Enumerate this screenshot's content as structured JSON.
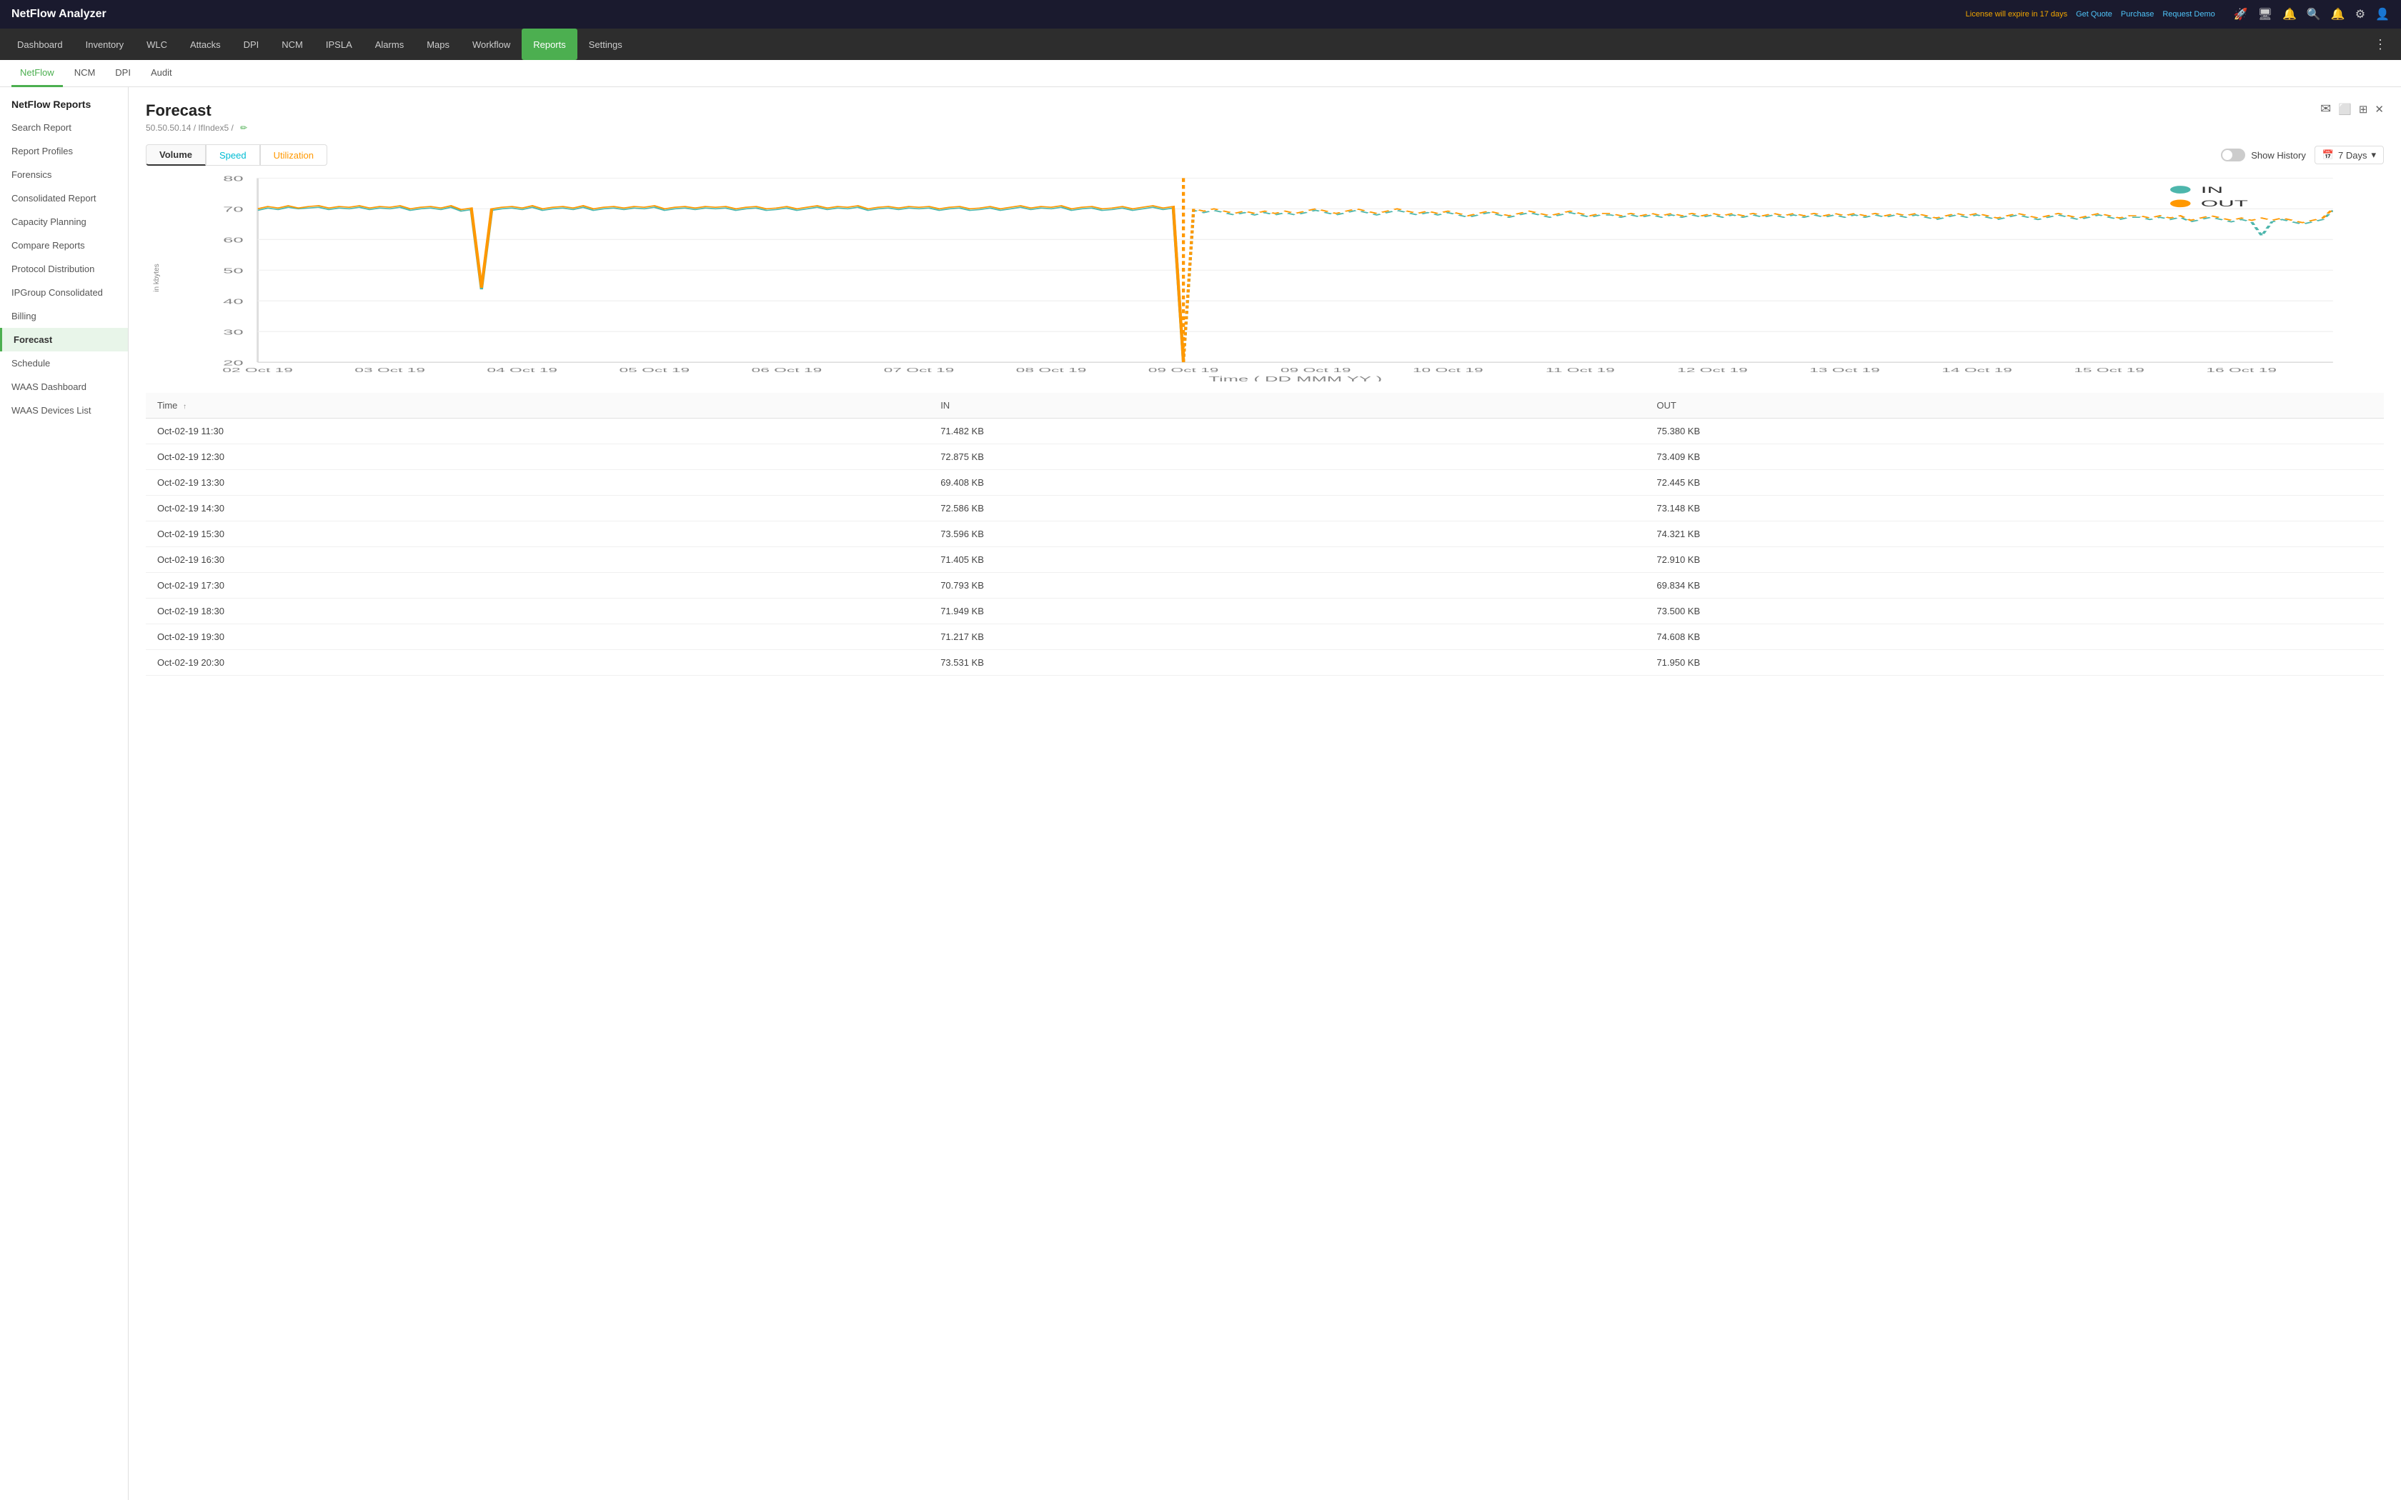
{
  "app": {
    "title": "NetFlow",
    "title_accent": " Analyzer"
  },
  "topbar": {
    "license": "License will expire in 17 days",
    "get_quote": "Get Quote",
    "purchase": "Purchase",
    "request_demo": "Request Demo"
  },
  "main_nav": {
    "items": [
      {
        "label": "Dashboard",
        "active": false
      },
      {
        "label": "Inventory",
        "active": false
      },
      {
        "label": "WLC",
        "active": false
      },
      {
        "label": "Attacks",
        "active": false
      },
      {
        "label": "DPI",
        "active": false
      },
      {
        "label": "NCM",
        "active": false
      },
      {
        "label": "IPSLA",
        "active": false
      },
      {
        "label": "Alarms",
        "active": false
      },
      {
        "label": "Maps",
        "active": false
      },
      {
        "label": "Workflow",
        "active": false
      },
      {
        "label": "Reports",
        "active": true
      },
      {
        "label": "Settings",
        "active": false
      }
    ]
  },
  "sub_nav": {
    "items": [
      {
        "label": "NetFlow",
        "active": true
      },
      {
        "label": "NCM",
        "active": false
      },
      {
        "label": "DPI",
        "active": false
      },
      {
        "label": "Audit",
        "active": false
      }
    ]
  },
  "sidebar": {
    "title": "NetFlow Reports",
    "items": [
      {
        "label": "Search Report",
        "active": false
      },
      {
        "label": "Report Profiles",
        "active": false
      },
      {
        "label": "Forensics",
        "active": false
      },
      {
        "label": "Consolidated Report",
        "active": false
      },
      {
        "label": "Capacity Planning",
        "active": false
      },
      {
        "label": "Compare Reports",
        "active": false
      },
      {
        "label": "Protocol Distribution",
        "active": false
      },
      {
        "label": "IPGroup Consolidated",
        "active": false
      },
      {
        "label": "Billing",
        "active": false
      },
      {
        "label": "Forecast",
        "active": true
      },
      {
        "label": "Schedule",
        "active": false
      },
      {
        "label": "WAAS Dashboard",
        "active": false
      },
      {
        "label": "WAAS Devices List",
        "active": false
      }
    ]
  },
  "page": {
    "title": "Forecast",
    "breadcrumb_ip": "50.50.50.14",
    "breadcrumb_sep": "/",
    "breadcrumb_if": "IfIndex5",
    "breadcrumb_sep2": "/"
  },
  "tabs": [
    {
      "label": "Volume",
      "active": true,
      "color": "default"
    },
    {
      "label": "Speed",
      "active": false,
      "color": "teal"
    },
    {
      "label": "Utilization",
      "active": false,
      "color": "orange"
    }
  ],
  "chart_controls": {
    "show_history": "Show History",
    "days": "7 Days"
  },
  "legend": {
    "in_label": "IN",
    "out_label": "OUT",
    "in_color": "#4db6ac",
    "out_color": "#ff9800"
  },
  "chart": {
    "y_label": "in kbytes",
    "y_ticks": [
      20,
      30,
      40,
      50,
      60,
      70,
      80
    ],
    "x_label": "Time ( DD MMM YY )",
    "x_ticks": [
      "02 Oct 19",
      "03 Oct 19",
      "04 Oct 19",
      "05 Oct 19",
      "06 Oct 19",
      "07 Oct 19",
      "08 Oct 19",
      "09 Oct 19",
      "09 Oct 19",
      "10 Oct 19",
      "11 Oct 19",
      "12 Oct 19",
      "13 Oct 19",
      "14 Oct 19",
      "15 Oct 19",
      "16 Oct 19"
    ]
  },
  "table": {
    "columns": [
      {
        "label": "Time",
        "sortable": true
      },
      {
        "label": "IN",
        "sortable": false
      },
      {
        "label": "OUT",
        "sortable": false
      }
    ],
    "rows": [
      {
        "time": "Oct-02-19 11:30",
        "in": "71.482 KB",
        "out": "75.380 KB"
      },
      {
        "time": "Oct-02-19 12:30",
        "in": "72.875 KB",
        "out": "73.409 KB"
      },
      {
        "time": "Oct-02-19 13:30",
        "in": "69.408 KB",
        "out": "72.445 KB"
      },
      {
        "time": "Oct-02-19 14:30",
        "in": "72.586 KB",
        "out": "73.148 KB"
      },
      {
        "time": "Oct-02-19 15:30",
        "in": "73.596 KB",
        "out": "74.321 KB"
      },
      {
        "time": "Oct-02-19 16:30",
        "in": "71.405 KB",
        "out": "72.910 KB"
      },
      {
        "time": "Oct-02-19 17:30",
        "in": "70.793 KB",
        "out": "69.834 KB"
      },
      {
        "time": "Oct-02-19 18:30",
        "in": "71.949 KB",
        "out": "73.500 KB"
      },
      {
        "time": "Oct-02-19 19:30",
        "in": "71.217 KB",
        "out": "74.608 KB"
      },
      {
        "time": "Oct-02-19 20:30",
        "in": "73.531 KB",
        "out": "71.950 KB"
      }
    ]
  },
  "icons": {
    "email": "✉",
    "pdf": "⬜",
    "export": "⊞",
    "close": "✕",
    "edit": "✏",
    "rocket": "🚀",
    "monitor": "🖥",
    "bell_outline": "🔔",
    "search": "🔍",
    "bell": "🔔",
    "gear": "⚙",
    "user": "👤",
    "calendar": "📅",
    "chevron_down": "▾",
    "sort_up": "↑"
  }
}
